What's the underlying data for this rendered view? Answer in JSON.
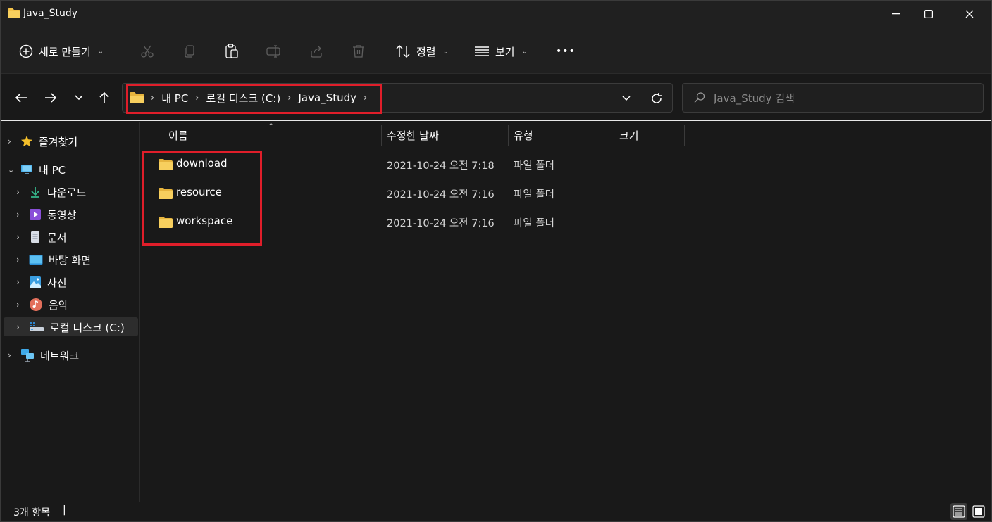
{
  "window": {
    "title": "Java_Study"
  },
  "toolbar": {
    "new_label": "새로 만들기",
    "sort_label": "정렬",
    "view_label": "보기",
    "more_label": "•••"
  },
  "address": {
    "crumbs": [
      "내 PC",
      "로컬 디스크 (C:)",
      "Java_Study"
    ]
  },
  "search": {
    "placeholder": "Java_Study 검색"
  },
  "sidebar": {
    "items": [
      {
        "label": "즐겨찾기",
        "icon": "star-icon"
      },
      {
        "label": "내 PC",
        "icon": "pc-icon"
      },
      {
        "label": "다운로드",
        "icon": "download-icon"
      },
      {
        "label": "동영상",
        "icon": "video-icon"
      },
      {
        "label": "문서",
        "icon": "document-icon"
      },
      {
        "label": "바탕 화면",
        "icon": "desktop-icon"
      },
      {
        "label": "사진",
        "icon": "pictures-icon"
      },
      {
        "label": "음악",
        "icon": "music-icon"
      },
      {
        "label": "로컬 디스크 (C:)",
        "icon": "drive-icon"
      },
      {
        "label": "네트워크",
        "icon": "network-icon"
      }
    ]
  },
  "columns": {
    "name": "이름",
    "date": "수정한 날짜",
    "type": "유형",
    "size": "크기"
  },
  "files": [
    {
      "name": "download",
      "date": "2021-10-24 오전 7:18",
      "type": "파일 폴더"
    },
    {
      "name": "resource",
      "date": "2021-10-24 오전 7:16",
      "type": "파일 폴더"
    },
    {
      "name": "workspace",
      "date": "2021-10-24 오전 7:16",
      "type": "파일 폴더"
    }
  ],
  "status": {
    "count": "3개 항목",
    "separator": "|"
  },
  "colors": {
    "highlight": "#e01e2a",
    "folder": "#f3c24a"
  }
}
